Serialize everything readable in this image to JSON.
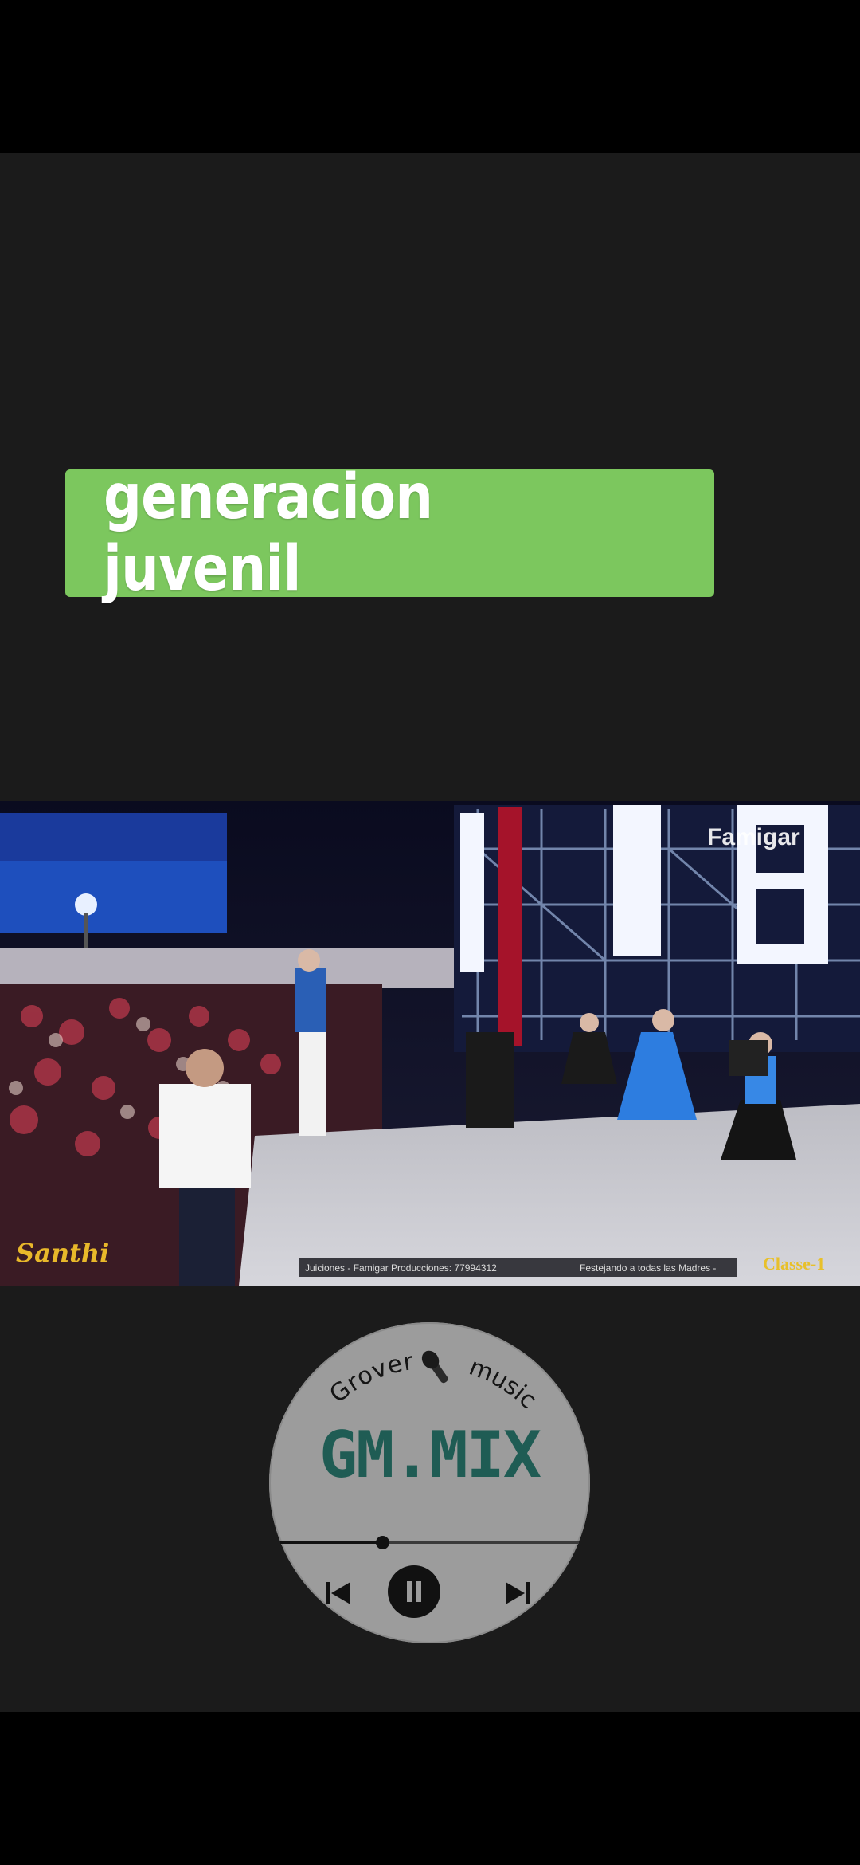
{
  "title": {
    "text": "generacion juvenil"
  },
  "video": {
    "watermark_left": "Santhi",
    "watermark_right": "Famigar",
    "corner_logo": "Classe-1",
    "ticker_left": "Juiciones -    Famigar Producciones: 77994312",
    "ticker_right": "Festejando a todas las Madres -"
  },
  "player": {
    "brand_top": "Grover",
    "brand_top_right": "music",
    "brand_main": "GM.MIX",
    "progress": 0.34
  }
}
